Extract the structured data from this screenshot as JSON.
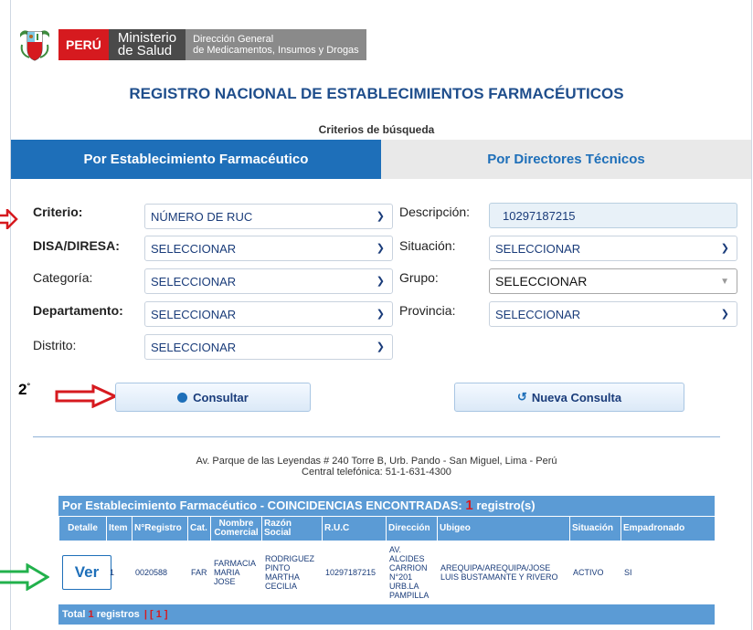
{
  "header": {
    "peru": "PERÚ",
    "ministerio_line1": "Ministerio",
    "ministerio_line2": "de Salud",
    "direccion_line1": "Dirección General",
    "direccion_line2": "de Medicamentos, Insumos y Drogas"
  },
  "title": "REGISTRO NACIONAL DE ESTABLECIMIENTOS FARMACÉUTICOS",
  "subtitle": "Criterios de búsqueda",
  "tabs": [
    {
      "label": "Por Establecimiento Farmacéutico",
      "active": true
    },
    {
      "label": "Por Directores Técnicos",
      "active": false
    }
  ],
  "form": {
    "criterio_label": "Criterio:",
    "criterio_value": "NÚMERO DE RUC",
    "descripcion_label": "Descripción:",
    "descripcion_value": "10297187215",
    "disa_label": "DISA/DIRESA:",
    "disa_value": "SELECCIONAR",
    "situacion_label": "Situación:",
    "situacion_value": "SELECCIONAR",
    "categoria_label": "Categoría:",
    "categoria_value": "SELECCIONAR",
    "grupo_label": "Grupo:",
    "grupo_value": "SELECCIONAR",
    "departamento_label": "Departamento:",
    "departamento_value": "SELECCIONAR",
    "provincia_label": "Provincia:",
    "provincia_value": "SELECCIONAR",
    "distrito_label": "Distrito:",
    "distrito_value": "SELECCIONAR"
  },
  "buttons": {
    "consultar": "Consultar",
    "nueva_consulta": "Nueva Consulta"
  },
  "step_label": "2",
  "step_sup": "°",
  "footer": {
    "address": "Av. Parque de las Leyendas # 240 Torre B, Urb. Pando - San Miguel, Lima - Perú",
    "phone": "Central telefónica: 51-1-631-4300"
  },
  "results": {
    "header_prefix": "Por Establecimiento Farmacéutico - COINCIDENCIAS ENCONTRADAS:",
    "count": "1",
    "header_suffix": "registro(s)",
    "columns": [
      "Detalle",
      "Item",
      "N°Registro",
      "Cat.",
      "Nombre Comercial",
      "Razón Social",
      "R.U.C",
      "Dirección",
      "Ubigeo",
      "Situación",
      "Empadronado"
    ],
    "row": {
      "detalle": "Ver",
      "item": "1",
      "registro": "0020588",
      "cat": "FAR",
      "nombre": "FARMACIA MARIA JOSE",
      "razon": "RODRIGUEZ PINTO MARTHA CECILIA",
      "ruc": "10297187215",
      "direccion": "AV. ALCIDES CARRION N°201 URB.LA PAMPILLA",
      "ubigeo": "AREQUIPA/AREQUIPA/JOSE LUIS BUSTAMANTE Y RIVERO",
      "situacion": "ACTIVO",
      "empadronado": "SI"
    },
    "footer_total": "Total",
    "footer_count": "1",
    "footer_registros": "registros",
    "footer_page": "[ 1 ]"
  },
  "colors": {
    "tab_active": "#1e6fb9",
    "title": "#1f4e8c",
    "table_header": "#5b9bd5",
    "arrow_red": "#d61a1f",
    "arrow_green": "#22b14c"
  }
}
